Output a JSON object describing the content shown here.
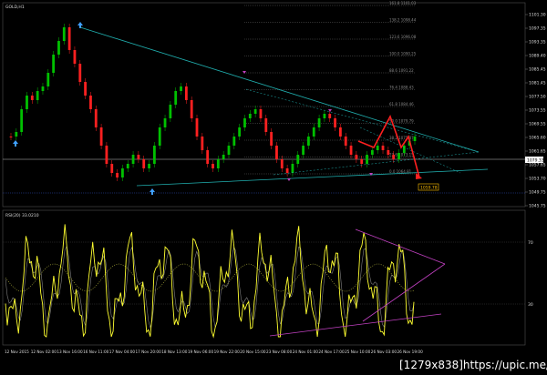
{
  "symbol_label": "GOLD,H1",
  "rsi_label": "RSI(20) 33.0210",
  "price_axis": [
    "1101.30",
    "1097.35",
    "1093.35",
    "1089.40",
    "1085.45",
    "1081.45",
    "1077.50",
    "1073.55",
    "1069.55",
    "1065.60",
    "1061.65",
    "1057.65",
    "1053.70",
    "1049.75",
    "1045.75"
  ],
  "rsi_axis": [
    "70",
    "30"
  ],
  "current_price": "1079.33",
  "target_price": "1059.78",
  "fib_levels": [
    "161.8 1101.03",
    "138.2 1098.44",
    "123.6 1096.08",
    "100.0 1090.25",
    "88.6 1091.22",
    "76.4 1088.43",
    "61.8 1084.46",
    "50.0 1079.79",
    "38.2 1075.87",
    "23.6 1073.15",
    "0.0 1064.81"
  ],
  "time_labels": [
    "12 Nov 2015",
    "12 Nov 02:00",
    "13 Nov 16:00",
    "16 Nov 11:00",
    "17 Nov 04:00",
    "17 Nov 20:00",
    "18 Nov 13:00",
    "19 Nov 06:00",
    "19 Nov 22:00",
    "20 Nov 15:00",
    "23 Nov 08:00",
    "24 Nov 01:00",
    "24 Nov 17:00",
    "25 Nov 10:00",
    "26 Nov 03:00",
    "26 Nov 19:00"
  ],
  "watermark": "[1279x838]https://upic.me/",
  "colors": {
    "bull": "#00c000",
    "bear": "#ff2020",
    "trend": "#20b0b0",
    "rsi": "#ffff30",
    "rsi_fast": "#808080",
    "projection": "#ff2020",
    "triangle": "#c040c0",
    "fib": "#606060"
  }
}
